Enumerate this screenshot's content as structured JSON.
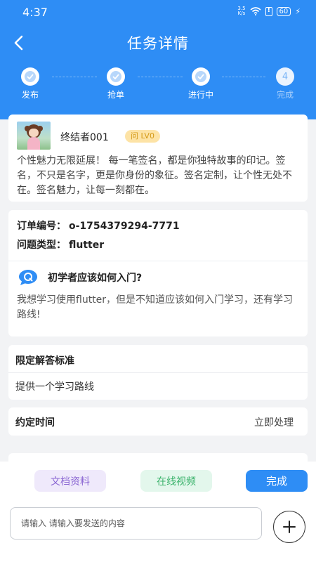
{
  "status_bar": {
    "time": "4:37",
    "net_speed_top": "3.5",
    "net_speed_bottom": "K/s",
    "battery": "60"
  },
  "nav": {
    "title": "任务详情"
  },
  "steps": [
    {
      "label": "发布",
      "done": true
    },
    {
      "label": "抢单",
      "done": true
    },
    {
      "label": "进行中",
      "done": true
    },
    {
      "label": "完成",
      "number": "4",
      "done": false
    }
  ],
  "user": {
    "name": "终结者001",
    "level": "问 LV0",
    "bio": "个性魅力无限延展！ 每一笔签名，都是你独特故事的印记。签名，不只是名字，更是你身份的象征。签名定制，让个性无处不在。签名魅力，让每一刻都在。"
  },
  "order": {
    "number_label": "订单编号：",
    "number_value": "o-1754379294-7771",
    "type_label": "问题类型：",
    "type_value": "flutter",
    "question_title": "初学者应该如何入门?",
    "question_desc": "我想学习使用flutter，但是不知道应该如何入门学习，还有学习路线!"
  },
  "standard": {
    "title": "限定解答标准",
    "value": "提供一个学习路线"
  },
  "appointment": {
    "label": "约定时间",
    "value": "立即处理"
  },
  "actions": {
    "docs": "文档资料",
    "video": "在线视频",
    "done": "完成"
  },
  "composer": {
    "placeholder": "请输入 请输入要发送的内容"
  },
  "colors": {
    "primary": "#2e8df5",
    "level_badge": "#fde3a6",
    "docs_pill": "#efe9fb",
    "video_pill": "#e3f7ec"
  }
}
